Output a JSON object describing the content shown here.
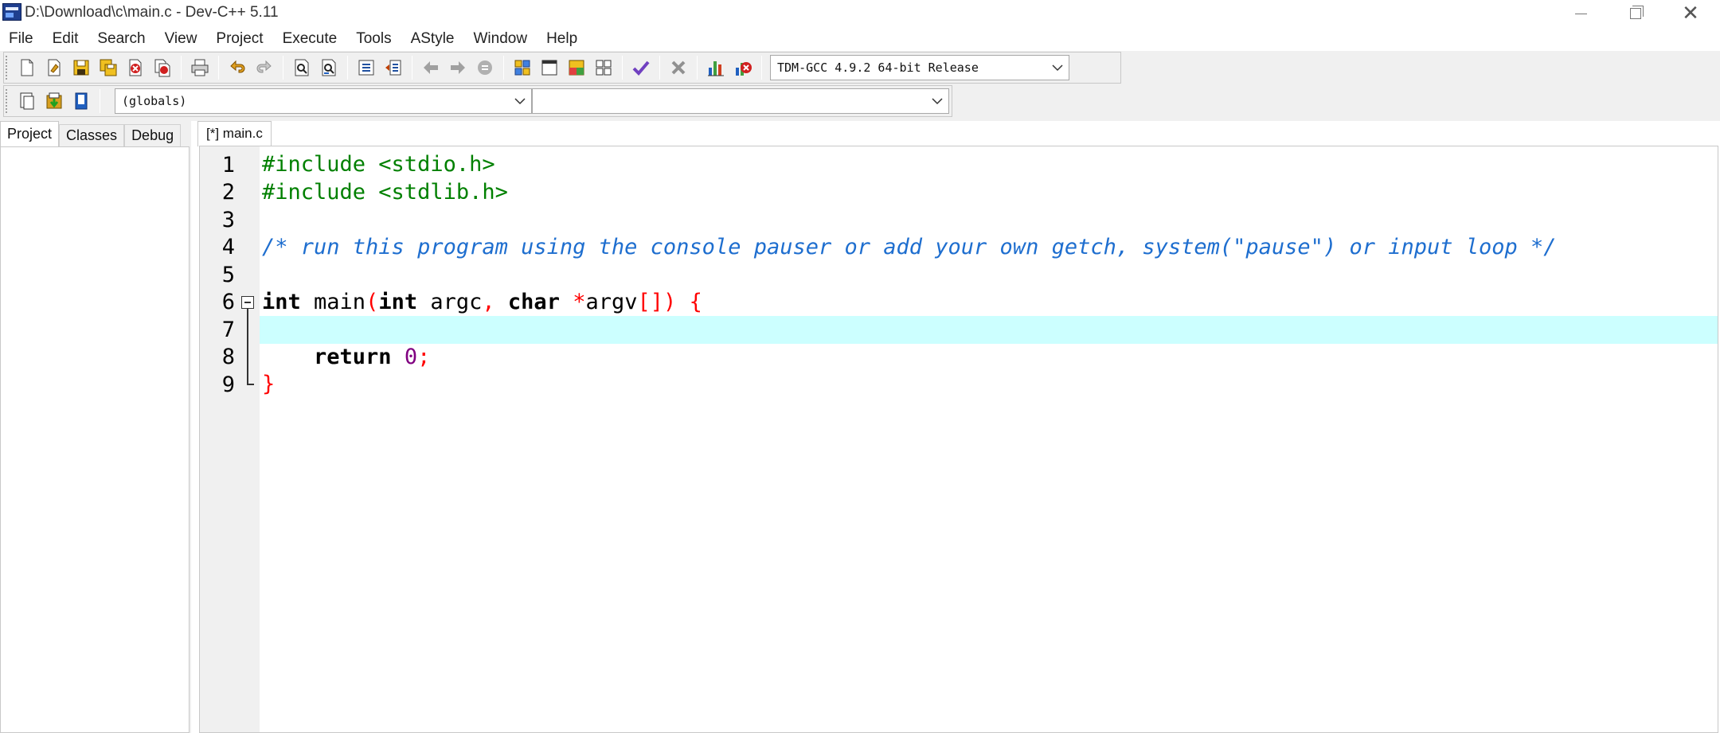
{
  "window": {
    "title": "D:\\Download\\c\\main.c - Dev-C++ 5.11"
  },
  "menu": [
    "File",
    "Edit",
    "Search",
    "View",
    "Project",
    "Execute",
    "Tools",
    "AStyle",
    "Window",
    "Help"
  ],
  "toolbar": {
    "compiler_selected": "TDM-GCC 4.9.2 64-bit Release",
    "scope_selected": "(globals)",
    "member_selected": ""
  },
  "left_panel": {
    "tabs": [
      "Project",
      "Classes",
      "Debug"
    ],
    "active_tab": "Project"
  },
  "editor": {
    "tab_label": "[*] main.c",
    "active_line": 7,
    "lines": [
      {
        "num": "1",
        "segments": [
          {
            "t": "#include <stdio.h>",
            "c": "pp"
          }
        ]
      },
      {
        "num": "2",
        "segments": [
          {
            "t": "#include <stdlib.h>",
            "c": "pp"
          }
        ]
      },
      {
        "num": "3",
        "segments": []
      },
      {
        "num": "4",
        "segments": [
          {
            "t": "/* run this program using the console pauser or add your own getch, system(\"pause\") or input loop */",
            "c": "cm"
          }
        ]
      },
      {
        "num": "5",
        "segments": []
      },
      {
        "num": "6",
        "segments": [
          {
            "t": "int",
            "c": "kw"
          },
          {
            "t": " main",
            "c": ""
          },
          {
            "t": "(",
            "c": "sym"
          },
          {
            "t": "int",
            "c": "kw"
          },
          {
            "t": " argc",
            "c": ""
          },
          {
            "t": ",",
            "c": "sym"
          },
          {
            "t": " ",
            "c": ""
          },
          {
            "t": "char",
            "c": "kw"
          },
          {
            "t": " ",
            "c": ""
          },
          {
            "t": "*",
            "c": "sym"
          },
          {
            "t": "argv",
            "c": ""
          },
          {
            "t": "[])",
            "c": "sym"
          },
          {
            "t": " ",
            "c": ""
          },
          {
            "t": "{",
            "c": "sym"
          }
        ]
      },
      {
        "num": "7",
        "segments": []
      },
      {
        "num": "8",
        "segments": [
          {
            "t": "    ",
            "c": ""
          },
          {
            "t": "return",
            "c": "kw"
          },
          {
            "t": " ",
            "c": ""
          },
          {
            "t": "0",
            "c": "num"
          },
          {
            "t": ";",
            "c": "sym"
          }
        ]
      },
      {
        "num": "9",
        "segments": [
          {
            "t": "}",
            "c": "sym"
          }
        ]
      }
    ]
  },
  "colors": {
    "preprocessor": "#008000",
    "comment": "#1e6ecf",
    "symbol": "#ff0000",
    "number": "#800080",
    "active_line": "#ccffff"
  },
  "icons": {
    "toolbar1": [
      "new-file-icon",
      "open-file-icon",
      "save-icon",
      "save-all-icon",
      "close-icon",
      "close-all-icon",
      "print-icon",
      "undo-icon",
      "redo-icon",
      "find-icon",
      "replace-icon",
      "indent-icon",
      "unindent-icon",
      "back-icon",
      "forward-icon",
      "bookmark-icon",
      "compile-icon",
      "run-icon",
      "compile-run-icon",
      "rebuild-icon",
      "syntax-check-icon",
      "stop-icon",
      "chart-icon",
      "profile-delete-icon"
    ],
    "toolbar2": [
      "new-class-icon",
      "add-to-project-icon",
      "project-options-icon"
    ]
  }
}
